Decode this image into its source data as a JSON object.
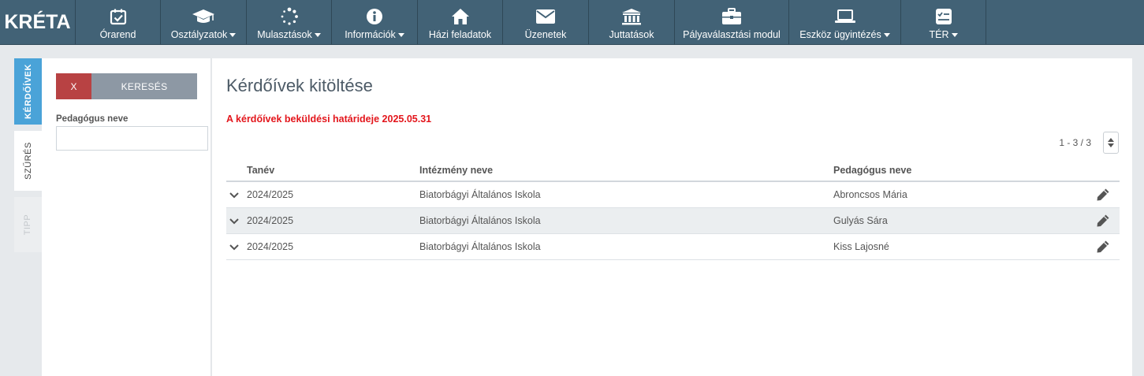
{
  "app": {
    "logo_text": "KRÉTA"
  },
  "nav": [
    {
      "id": "orarend",
      "label": "Órarend",
      "icon": "calendar-check-icon",
      "dropdown": false
    },
    {
      "id": "osztalyzatok",
      "label": "Osztályzatok",
      "icon": "graduation-cap-icon",
      "dropdown": true
    },
    {
      "id": "mulasztasok",
      "label": "Mulasztások",
      "icon": "spinner-icon",
      "dropdown": true
    },
    {
      "id": "informaciok",
      "label": "Információk",
      "icon": "info-circle-icon",
      "dropdown": true
    },
    {
      "id": "hazi",
      "label": "Házi feladatok",
      "icon": "home-icon",
      "dropdown": false
    },
    {
      "id": "uzenetek",
      "label": "Üzenetek",
      "icon": "envelope-icon",
      "dropdown": false
    },
    {
      "id": "juttatasok",
      "label": "Juttatások",
      "icon": "bank-icon",
      "dropdown": false
    },
    {
      "id": "palya",
      "label": "Pályaválasztási modul",
      "icon": "briefcase-icon",
      "dropdown": false
    },
    {
      "id": "eszkoz",
      "label": "Eszköz ügyintézés",
      "icon": "laptop-icon",
      "dropdown": true
    },
    {
      "id": "ter",
      "label": "TÉR",
      "icon": "checklist-icon",
      "dropdown": true
    }
  ],
  "side_tabs": {
    "kerdoivek": "KÉRDŐÍVEK",
    "szures": "SZŰRÉS",
    "tipp": "TIPP"
  },
  "filter": {
    "clear_label": "X",
    "search_label": "KERESÉS",
    "field_label": "Pedagógus neve",
    "field_value": ""
  },
  "main": {
    "title": "Kérdőívek kitöltése",
    "deadline": "A kérdőívek beküldési határideje 2025.05.31",
    "pager": "1 - 3 / 3"
  },
  "table": {
    "headers": {
      "year": "Tanév",
      "institution": "Intézmény neve",
      "teacher": "Pedagógus neve"
    },
    "rows": [
      {
        "year": "2024/2025",
        "institution": "Biatorbágyi Általános Iskola",
        "teacher": "Abroncsos Mária"
      },
      {
        "year": "2024/2025",
        "institution": "Biatorbágyi Általános Iskola",
        "teacher": "Gulyás Sára"
      },
      {
        "year": "2024/2025",
        "institution": "Biatorbágyi Általános Iskola",
        "teacher": "Kiss Lajosné"
      }
    ]
  },
  "colors": {
    "nav_bg": "#426276",
    "active_tab": "#4aa3d8",
    "deadline": "#e3161c",
    "clear_button": "#b84243",
    "search_button": "#8d98a4"
  }
}
